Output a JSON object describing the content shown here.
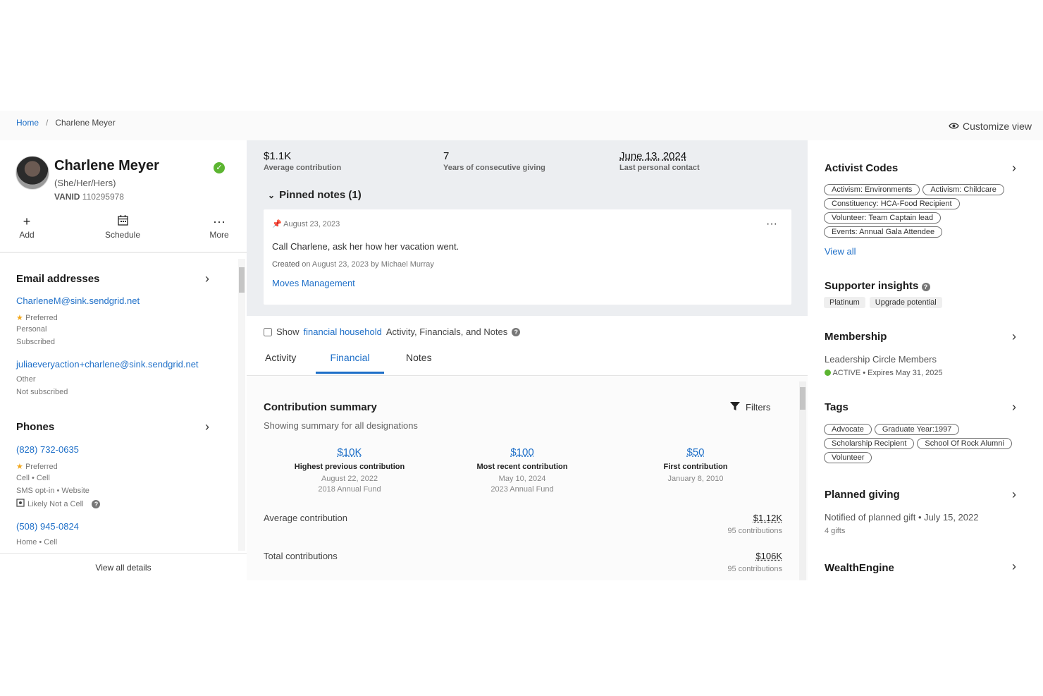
{
  "breadcrumb": {
    "home": "Home",
    "separator": "/",
    "current": "Charlene Meyer"
  },
  "customize_view": "Customize view",
  "profile": {
    "name": "Charlene Meyer",
    "pronouns": "(She/Her/Hers)",
    "vanid_label": "VANID",
    "vanid": "110295978",
    "actions": [
      {
        "icon": "plus-icon",
        "label": "Add"
      },
      {
        "icon": "calendar-icon",
        "label": "Schedule"
      },
      {
        "icon": "more-icon",
        "label": "More"
      }
    ]
  },
  "email": {
    "title": "Email addresses",
    "items": [
      {
        "address": "CharleneM@sink.sendgrid.net",
        "preferred": "Preferred",
        "type": "Personal",
        "status": "Subscribed"
      },
      {
        "address": "juliaeveryaction+charlene@sink.sendgrid.net",
        "type": "Other",
        "status": "Not subscribed"
      }
    ]
  },
  "phones": {
    "title": "Phones",
    "items": [
      {
        "number": "(828) 732-0635",
        "preferred": "Preferred",
        "type": "Cell • Cell",
        "sms": "SMS opt-in • Website",
        "likely": "Likely Not a Cell"
      },
      {
        "number": "(508) 945-0824",
        "type": "Home • Cell"
      }
    ]
  },
  "view_all_details": "View all details",
  "stats": [
    {
      "value": "$1.1K",
      "label": "Average contribution"
    },
    {
      "value": "7",
      "label": "Years of consecutive giving"
    },
    {
      "value": "June 13, 2024",
      "label": "Last personal contact"
    }
  ],
  "pinned": {
    "header": "Pinned notes (1)",
    "note": {
      "date": "August 23, 2023",
      "text": "Call Charlene, ask her how her vacation went.",
      "created_prefix": "Created",
      "created": "on August 23, 2023 by Michael Murray",
      "link": "Moves Management"
    }
  },
  "household": {
    "prefix": "Show",
    "link": "financial household",
    "suffix": "Activity, Financials, and Notes"
  },
  "tabs": [
    "Activity",
    "Financial",
    "Notes"
  ],
  "financial": {
    "title": "Contribution summary",
    "subtitle": "Showing summary for all designations",
    "filters": "Filters",
    "kpis": [
      {
        "value": "$10K",
        "label": "Highest previous contribution",
        "date": "August 22, 2022",
        "fund": "2018 Annual Fund"
      },
      {
        "value": "$100",
        "label": "Most recent contribution",
        "date": "May 10, 2024",
        "fund": "2023 Annual Fund"
      },
      {
        "value": "$50",
        "label": "First contribution",
        "date": "January 8, 2010",
        "fund": ""
      }
    ],
    "rows": [
      {
        "label": "Average contribution",
        "value": "$1.12K",
        "sub": "95 contributions"
      },
      {
        "label": "Total contributions",
        "value": "$106K",
        "sub": "95 contributions"
      }
    ]
  },
  "activist_codes": {
    "title": "Activist Codes",
    "items": [
      "Activism: Environments",
      "Activism: Childcare",
      "Constituency: HCA-Food Recipient",
      "Volunteer: Team Captain lead",
      "Events: Annual Gala Attendee"
    ],
    "view_all": "View all"
  },
  "supporter_insights": {
    "title": "Supporter insights",
    "items": [
      "Platinum",
      "Upgrade potential"
    ]
  },
  "membership": {
    "title": "Membership",
    "name": "Leadership Circle Members",
    "status": "ACTIVE",
    "expires": "• Expires May 31, 2025"
  },
  "tags": {
    "title": "Tags",
    "items": [
      "Advocate",
      "Graduate Year:1997",
      "Scholarship Recipient",
      "School Of Rock Alumni",
      "Volunteer"
    ]
  },
  "planned_giving": {
    "title": "Planned giving",
    "text": "Notified of planned gift • July 15, 2022",
    "sub": "4 gifts"
  },
  "wealthengine": {
    "title": "WealthEngine"
  },
  "colors": {
    "accent": "#1e6fc8",
    "success": "#5cb531",
    "panel": "#eceef1"
  }
}
